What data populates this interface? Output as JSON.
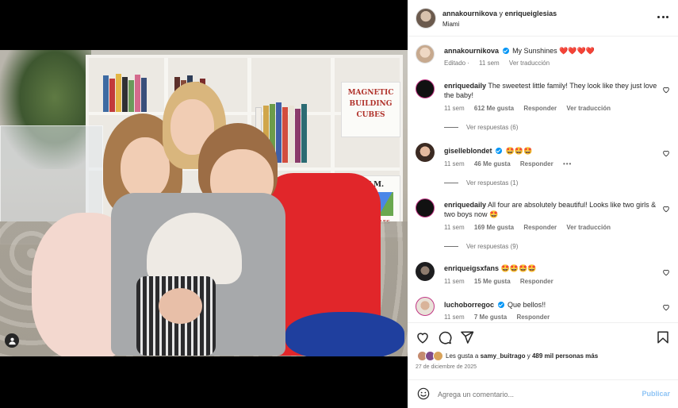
{
  "post": {
    "author": "annakournikova",
    "connector": "y",
    "collaborator": "enriqueiglesias",
    "location": "Miami"
  },
  "caption": {
    "username": "annakournikova",
    "text": "My Sunshines",
    "hearts": "❤️❤️❤️❤️",
    "edited": "Editado",
    "time": "11 sem",
    "translate": "Ver traducción"
  },
  "photo": {
    "sign1": [
      "MAGNETIC",
      "BUILDING",
      "CUBES"
    ],
    "sign2": [
      "L.N.M.",
      "MAGNA-TILES"
    ]
  },
  "comments": [
    {
      "username": "enriquedaily",
      "text": "The sweetest little family! They look like they just love the baby!",
      "time": "11 sem",
      "likes": "612 Me gusta",
      "reply": "Responder",
      "translate": "Ver traducción",
      "view_replies": "Ver respuestas (6)"
    },
    {
      "username": "giselleblondet",
      "text": "🤩🤩🤩",
      "time": "11 sem",
      "likes": "46 Me gusta",
      "reply": "Responder",
      "more": "•••",
      "view_replies": "Ver respuestas (1)"
    },
    {
      "username": "enriquedaily",
      "text": "All four are absolutely beautiful! Looks like two girls & two boys now 🤩",
      "time": "11 sem",
      "likes": "169 Me gusta",
      "reply": "Responder",
      "translate": "Ver traducción",
      "view_replies": "Ver respuestas (9)"
    },
    {
      "username": "enriqueigsxfans",
      "text": "🤩🤩🤩🤩",
      "time": "11 sem",
      "likes": "15 Me gusta",
      "reply": "Responder"
    },
    {
      "username": "luchoborregoc",
      "text": "Que bellos!!",
      "time": "11 sem",
      "likes": "7 Me gusta",
      "reply": "Responder"
    }
  ],
  "likes_summary": {
    "prefix": "Les gusta a",
    "user": "samy_buitrago",
    "middle": "y",
    "count": "489 mil personas más"
  },
  "date": "27 de diciembre de 2025",
  "comment_box": {
    "placeholder": "Agrega un comentario...",
    "publish": "Publicar"
  },
  "icons": {
    "heart": "heart-icon",
    "comment": "comment-icon",
    "share": "share-icon",
    "save": "bookmark-icon",
    "emoji": "smiley-icon",
    "tag": "user-tag-icon",
    "more": "more-icon",
    "verified": "verified-badge-icon"
  },
  "colors": {
    "verified": "#0095f6",
    "publish_disabled": "#8ec4f5",
    "heart_red": "#ed4956",
    "secondary_text": "#737373"
  }
}
